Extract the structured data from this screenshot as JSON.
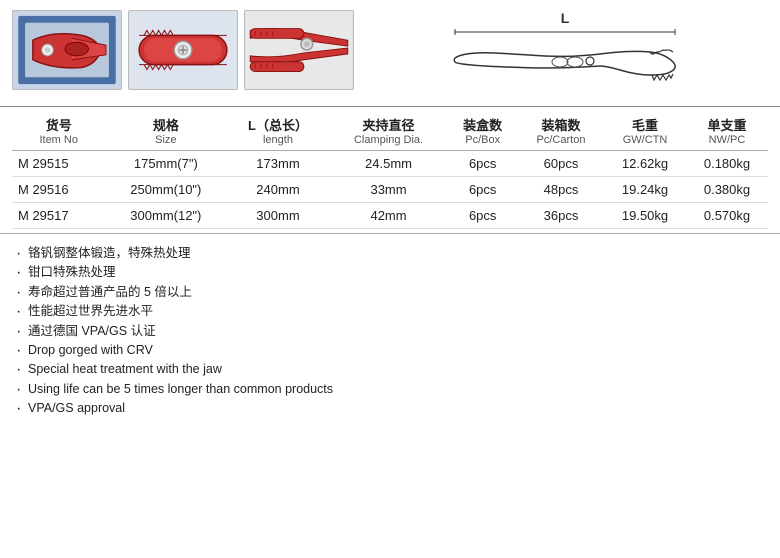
{
  "diagram": {
    "label_l": "L"
  },
  "table": {
    "headers": [
      {
        "cn": "货号",
        "en": "Item No"
      },
      {
        "cn": "规格",
        "en": "Size"
      },
      {
        "cn": "L（总长）",
        "en": "length"
      },
      {
        "cn": "夹持直径",
        "en": "Clamping Dia."
      },
      {
        "cn": "装盒数",
        "en": "Pc/Box"
      },
      {
        "cn": "装箱数",
        "en": "Pc/Carton"
      },
      {
        "cn": "毛重",
        "en": "GW/CTN"
      },
      {
        "cn": "单支重",
        "en": "NW/PC"
      }
    ],
    "rows": [
      {
        "item_no": "M 29515",
        "size": "175mm(7\")",
        "length": "173mm",
        "clamping": "24.5mm",
        "pc_box": "6pcs",
        "pc_carton": "60pcs",
        "gw_ctn": "12.62kg",
        "nw_pc": "0.180kg"
      },
      {
        "item_no": "M 29516",
        "size": "250mm(10\")",
        "length": "240mm",
        "clamping": "33mm",
        "pc_box": "6pcs",
        "pc_carton": "48pcs",
        "gw_ctn": "19.24kg",
        "nw_pc": "0.380kg"
      },
      {
        "item_no": "M 29517",
        "size": "300mm(12\")",
        "length": "300mm",
        "clamping": "42mm",
        "pc_box": "6pcs",
        "pc_carton": "36pcs",
        "gw_ctn": "19.50kg",
        "nw_pc": "0.570kg"
      }
    ]
  },
  "features": [
    "铬钒钢整体锻造，特殊热处理",
    "钳口特殊热处理",
    "寿命超过普通产品的 5 倍以上",
    "性能超过世界先进水平",
    "通过德国 VPA/GS 认证",
    "Drop gorged with CRV",
    "Special heat treatment with the jaw",
    "Using life can be 5 times longer than common products",
    "VPA/GS approval"
  ]
}
